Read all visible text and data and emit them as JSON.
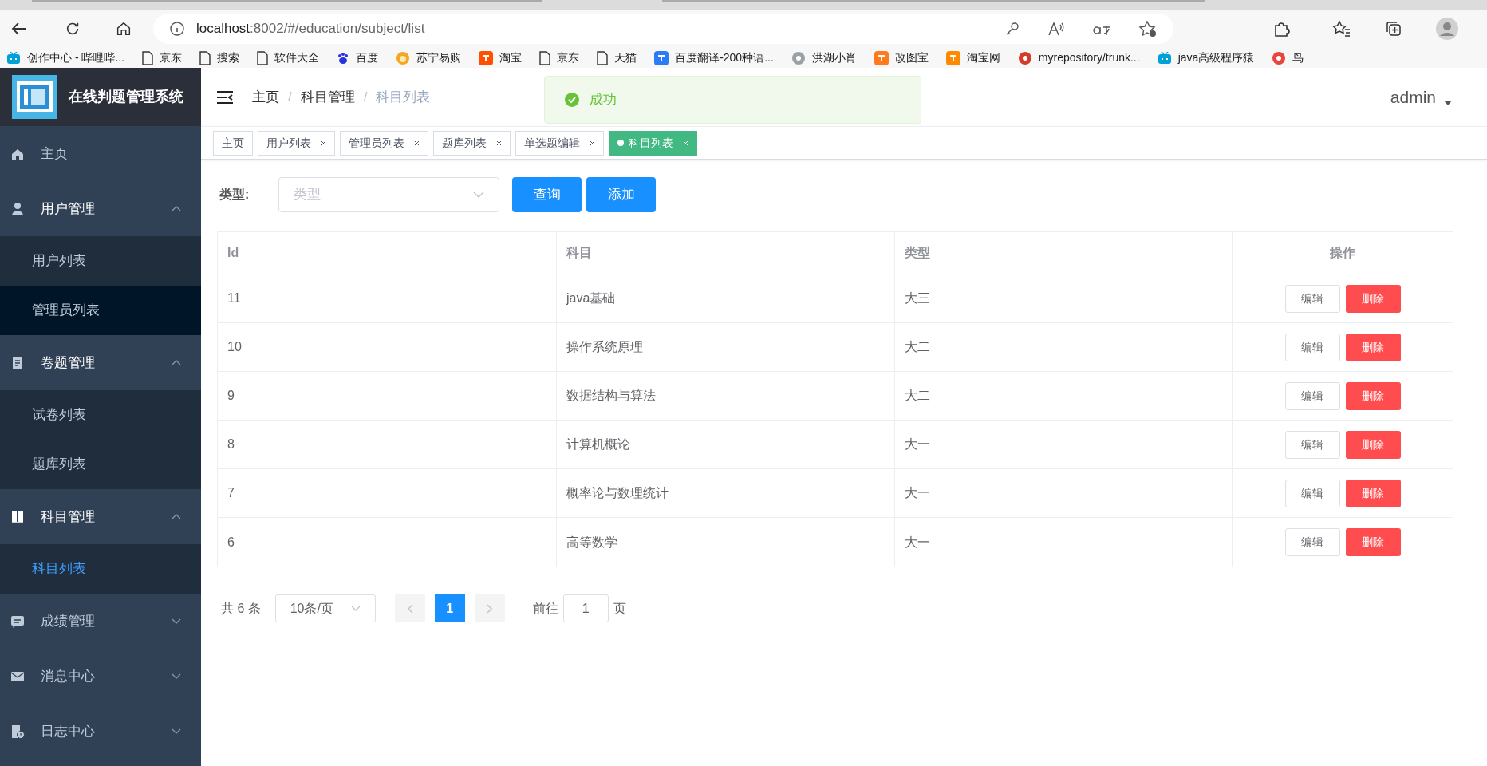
{
  "browser": {
    "url_host": "localhost",
    "url_path": ":8002/#/education/subject/list",
    "bookmarks": [
      {
        "label": "创作中心 - 哔哩哔...",
        "kind": "tv",
        "color": "#00a1d6"
      },
      {
        "label": "京东",
        "kind": "page"
      },
      {
        "label": "搜索",
        "kind": "page"
      },
      {
        "label": "软件大全",
        "kind": "page"
      },
      {
        "label": "百度",
        "kind": "paw",
        "color": "#2932e1"
      },
      {
        "label": "苏宁易购",
        "kind": "sun",
        "color": "#f5a623"
      },
      {
        "label": "淘宝",
        "kind": "square",
        "color": "#ff5000"
      },
      {
        "label": "京东",
        "kind": "page"
      },
      {
        "label": "天猫",
        "kind": "page"
      },
      {
        "label": "百度翻译-200种语...",
        "kind": "square",
        "color": "#2b7cf7"
      },
      {
        "label": "洪湖小肖",
        "kind": "circle",
        "color": "#9aa0a6"
      },
      {
        "label": "改图宝",
        "kind": "square",
        "color": "#ff7a1a"
      },
      {
        "label": "淘宝网",
        "kind": "square",
        "color": "#ff8a00"
      },
      {
        "label": "myrepository/trunk...",
        "kind": "circle",
        "color": "#d43b2a"
      },
      {
        "label": "java高级程序猿",
        "kind": "tv",
        "color": "#00a1d6"
      },
      {
        "label": "鸟",
        "kind": "circle",
        "color": "#e8453c"
      }
    ]
  },
  "app": {
    "title": "在线判题管理系统",
    "user": "admin"
  },
  "sidebar": {
    "items": [
      {
        "label": "主页",
        "kind": "item"
      },
      {
        "label": "用户管理",
        "kind": "group",
        "expanded": true,
        "children": [
          {
            "label": "用户列表",
            "selected": false,
            "hovered": false
          },
          {
            "label": "管理员列表",
            "selected": false,
            "hovered": true
          }
        ]
      },
      {
        "label": "卷题管理",
        "kind": "group",
        "expanded": true,
        "children": [
          {
            "label": "试卷列表",
            "selected": false,
            "hovered": false
          },
          {
            "label": "题库列表",
            "selected": false,
            "hovered": false
          }
        ]
      },
      {
        "label": "科目管理",
        "kind": "group",
        "expanded": true,
        "children": [
          {
            "label": "科目列表",
            "selected": true,
            "hovered": false
          }
        ]
      },
      {
        "label": "成绩管理",
        "kind": "group",
        "expanded": false
      },
      {
        "label": "消息中心",
        "kind": "group",
        "expanded": false
      },
      {
        "label": "日志中心",
        "kind": "group",
        "expanded": false
      }
    ]
  },
  "breadcrumb": [
    {
      "label": "主页"
    },
    {
      "separator": "/",
      "label": "科目管理"
    },
    {
      "separator": "/",
      "label": "科目列表"
    }
  ],
  "tags": [
    {
      "label": "主页",
      "closable": false,
      "selected": false
    },
    {
      "label": "用户列表",
      "closable": true,
      "selected": false
    },
    {
      "label": "管理员列表",
      "closable": true,
      "selected": false
    },
    {
      "label": "题库列表",
      "closable": true,
      "selected": false
    },
    {
      "label": "单选题编辑",
      "closable": true,
      "selected": false
    },
    {
      "label": "科目列表",
      "closable": true,
      "selected": true
    }
  ],
  "toast": {
    "message": "成功"
  },
  "filter": {
    "label": "类型:",
    "placeholder": "类型",
    "buttons": [
      "查询",
      "添加"
    ]
  },
  "table": {
    "columns": [
      "Id",
      "科目",
      "类型",
      "操作"
    ],
    "rows": [
      {
        "id": "11",
        "subject": "java基础",
        "type": "大三",
        "actions": [
          "编辑",
          "删除"
        ]
      },
      {
        "id": "10",
        "subject": "操作系统原理",
        "type": "大二",
        "actions": [
          "编辑",
          "删除"
        ]
      },
      {
        "id": "9",
        "subject": "数据结构与算法",
        "type": "大二",
        "actions": [
          "编辑",
          "删除"
        ]
      },
      {
        "id": "8",
        "subject": "计算机概论",
        "type": "大一",
        "actions": [
          "编辑",
          "删除"
        ]
      },
      {
        "id": "7",
        "subject": "概率论与数理统计",
        "type": "大一",
        "actions": [
          "编辑",
          "删除"
        ]
      },
      {
        "id": "6",
        "subject": "高等数学",
        "type": "大一",
        "actions": [
          "编辑",
          "删除"
        ]
      }
    ]
  },
  "pagination": {
    "total": "共 6 条",
    "page_size": "10条/页",
    "pages": [
      {
        "label": "1",
        "selected": true
      }
    ],
    "goto_label": "前往",
    "goto_value": "1",
    "goto_suffix": "页"
  }
}
